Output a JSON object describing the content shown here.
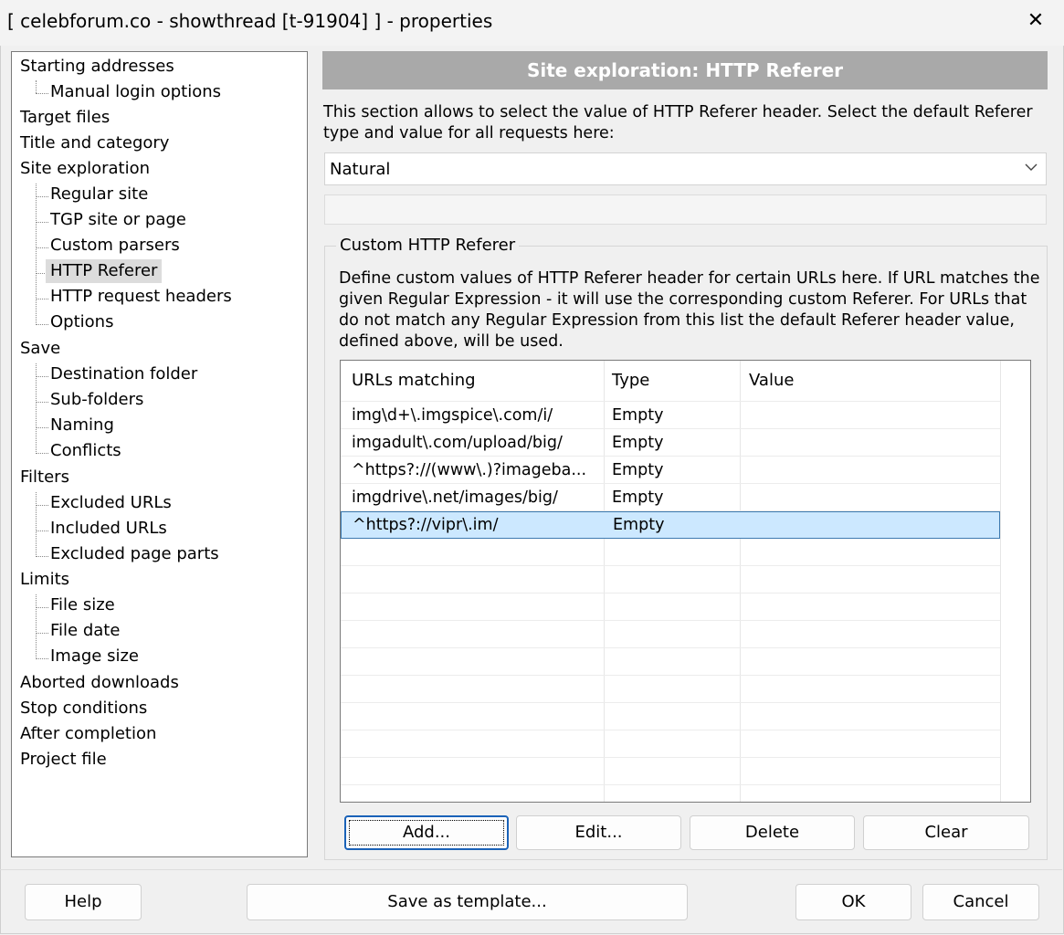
{
  "window": {
    "title": "[ celebforum.co - showthread [t-91904] ] - properties",
    "close_glyph": "✕"
  },
  "tree": {
    "items": [
      {
        "label": "Starting addresses"
      },
      {
        "label": "Manual login options"
      },
      {
        "label": "Target files"
      },
      {
        "label": "Title and category"
      },
      {
        "label": "Site exploration"
      },
      {
        "label": "Regular site"
      },
      {
        "label": "TGP site or page"
      },
      {
        "label": "Custom parsers"
      },
      {
        "label": "HTTP Referer"
      },
      {
        "label": "HTTP request headers"
      },
      {
        "label": "Options"
      },
      {
        "label": "Save"
      },
      {
        "label": "Destination folder"
      },
      {
        "label": "Sub-folders"
      },
      {
        "label": "Naming"
      },
      {
        "label": "Conflicts"
      },
      {
        "label": "Filters"
      },
      {
        "label": "Excluded URLs"
      },
      {
        "label": "Included URLs"
      },
      {
        "label": "Excluded page parts"
      },
      {
        "label": "Limits"
      },
      {
        "label": "File size"
      },
      {
        "label": "File date"
      },
      {
        "label": "Image size"
      },
      {
        "label": "Aborted downloads"
      },
      {
        "label": "Stop conditions"
      },
      {
        "label": "After completion"
      },
      {
        "label": "Project file"
      }
    ],
    "selected": "HTTP Referer"
  },
  "panel": {
    "header": "Site exploration: HTTP Referer",
    "description": "This section allows to select the value of HTTP Referer header. Select the default Referer type and value for all requests here:",
    "referer_type": "Natural",
    "group_title": "Custom HTTP Referer",
    "group_description": "Define custom values of HTTP Referer header for certain URLs here. If URL matches the given Regular Expression - it will use the corresponding custom Referer. For URLs that do not match any Regular Expression from this list the default Referer header value, defined above, will be used.",
    "columns": [
      "URLs matching",
      "Type",
      "Value"
    ],
    "rows": [
      {
        "url": "img\\d+\\.imgspice\\.com/i/",
        "type": "Empty",
        "value": ""
      },
      {
        "url": "imgadult\\.com/upload/big/",
        "type": "Empty",
        "value": ""
      },
      {
        "url": "^https?://(www\\.)?imageba...",
        "type": "Empty",
        "value": ""
      },
      {
        "url": "imgdrive\\.net/images/big/",
        "type": "Empty",
        "value": ""
      },
      {
        "url": "^https?://vipr\\.im/",
        "type": "Empty",
        "value": ""
      }
    ],
    "selected_row": 4,
    "buttons": {
      "add": "Add...",
      "edit": "Edit...",
      "delete": "Delete",
      "clear": "Clear"
    }
  },
  "footer": {
    "help": "Help",
    "save_template": "Save as template...",
    "ok": "OK",
    "cancel": "Cancel"
  }
}
